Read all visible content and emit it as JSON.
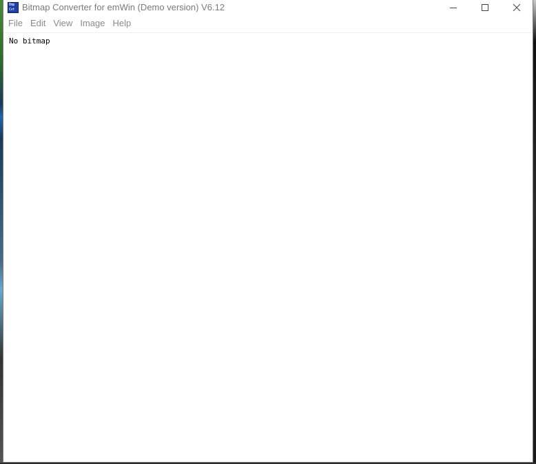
{
  "window": {
    "title": "Bitmap Converter for emWin (Demo version) V6.12",
    "icon": "bmp-cvt-app-icon",
    "icon_text_line1": "Bmp",
    "icon_text_line2": "Cvt"
  },
  "caption": {
    "minimize_icon": "minimize-icon",
    "maximize_icon": "maximize-icon",
    "close_icon": "close-icon"
  },
  "menu": {
    "items": [
      {
        "label": "File"
      },
      {
        "label": "Edit"
      },
      {
        "label": "View"
      },
      {
        "label": "Image"
      },
      {
        "label": "Help"
      }
    ]
  },
  "content": {
    "status": "No bitmap"
  },
  "colors": {
    "title_text": "#7a7a7a",
    "menu_text": "#8a8a8a",
    "icon_bg": "#1e3fa8"
  }
}
